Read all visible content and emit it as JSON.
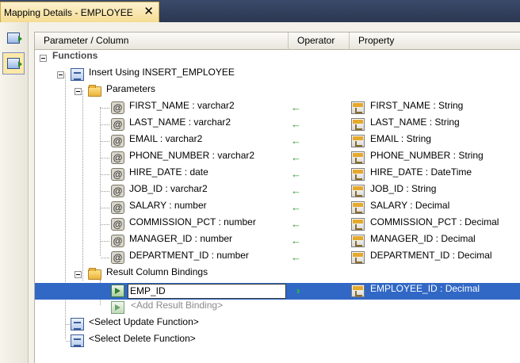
{
  "tab": {
    "title": "Mapping Details - EMPLOYEE",
    "close": "✕"
  },
  "toolbar": {
    "items": [
      "mapping-view",
      "insert-view"
    ]
  },
  "columns": {
    "param": "Parameter / Column",
    "operator": "Operator",
    "property": "Property"
  },
  "tree": {
    "functions": "Functions",
    "insert": "Insert Using INSERT_EMPLOYEE",
    "parameters": "Parameters",
    "params": [
      {
        "name": "FIRST_NAME : varchar2",
        "op": "←",
        "prop": "FIRST_NAME : String"
      },
      {
        "name": "LAST_NAME : varchar2",
        "op": "←",
        "prop": "LAST_NAME : String"
      },
      {
        "name": "EMAIL : varchar2",
        "op": "←",
        "prop": "EMAIL : String"
      },
      {
        "name": "PHONE_NUMBER : varchar2",
        "op": "←",
        "prop": "PHONE_NUMBER : String"
      },
      {
        "name": "HIRE_DATE : date",
        "op": "←",
        "prop": "HIRE_DATE : DateTime"
      },
      {
        "name": "JOB_ID : varchar2",
        "op": "←",
        "prop": "JOB_ID : String"
      },
      {
        "name": "SALARY : number",
        "op": "←",
        "prop": "SALARY : Decimal"
      },
      {
        "name": "COMMISSION_PCT : number",
        "op": "←",
        "prop": "COMMISSION_PCT : Decimal"
      },
      {
        "name": "MANAGER_ID : number",
        "op": "←",
        "prop": "MANAGER_ID : Decimal"
      },
      {
        "name": "DEPARTMENT_ID : number",
        "op": "←",
        "prop": "DEPARTMENT_ID : Decimal"
      }
    ],
    "param_icon": "@",
    "result_bindings": "Result Column Bindings",
    "binding": {
      "name": "EMP_ID",
      "op": "›",
      "prop": "EMPLOYEE_ID : Decimal"
    },
    "add_binding": "<Add Result Binding>",
    "update": "<Select Update Function>",
    "delete": "<Select Delete Function>"
  },
  "colors": {
    "selection": "#3168c6",
    "arrow": "#2f9a2f",
    "tab_bg": "#f5dc92"
  }
}
